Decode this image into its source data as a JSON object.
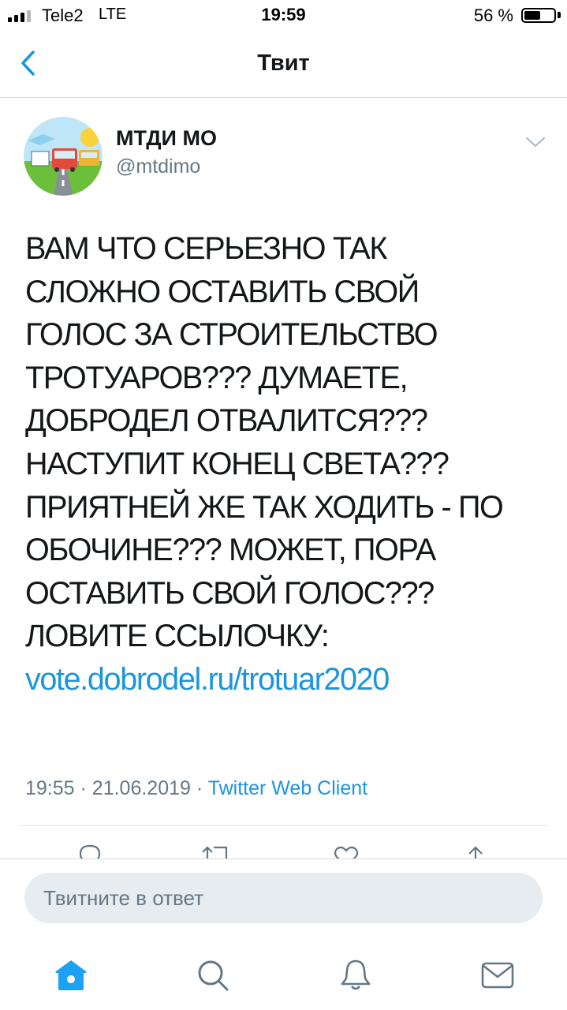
{
  "status_bar": {
    "carrier": "Tele2",
    "network": "LTE",
    "time": "19:59",
    "battery_percent": "56 %",
    "battery_level": 0.56
  },
  "nav": {
    "title": "Твит",
    "back_icon": "chevron-left-icon"
  },
  "tweet": {
    "author_name": "МТДИ МО",
    "author_handle": "@mtdimo",
    "text_lines": [
      "ВАМ ЧТО СЕРЬЕЗНО ТАК",
      "СЛОЖНО ОСТАВИТЬ СВОЙ",
      "ГОЛОС ЗА СТРОИТЕЛЬСТВО",
      "ТРОТУАРОВ??? ДУМАЕТЕ,",
      "ДОБРОДЕЛ ОТВАЛИТСЯ???",
      "НАСТУПИТ КОНЕЦ СВЕТА???",
      "ПРИЯТНЕЙ ЖЕ ТАК ХОДИТЬ - ПО",
      "ОБОЧИНЕ???  МОЖЕТ, ПОРА",
      "ОСТАВИТЬ СВОЙ ГОЛОС???",
      "ЛОВИТЕ ССЫЛОЧКУ:"
    ],
    "link": "vote.dobrodel.ru/trotuar2020",
    "time": "19:55",
    "separator": "·",
    "date": "21.06.2019",
    "source": "Twitter Web Client"
  },
  "actions": {
    "reply_icon": "reply-icon",
    "retweet_icon": "retweet-icon",
    "like_icon": "heart-icon",
    "share_icon": "share-icon"
  },
  "reply_bar": {
    "placeholder": "Твитните в ответ"
  },
  "tab_bar": {
    "items": [
      "home-icon",
      "search-icon",
      "notifications-icon",
      "messages-icon"
    ]
  },
  "colors": {
    "accent": "#1b95e0",
    "text": "#14171a",
    "secondary": "#657786",
    "reply_bg": "#e6ecf0"
  }
}
